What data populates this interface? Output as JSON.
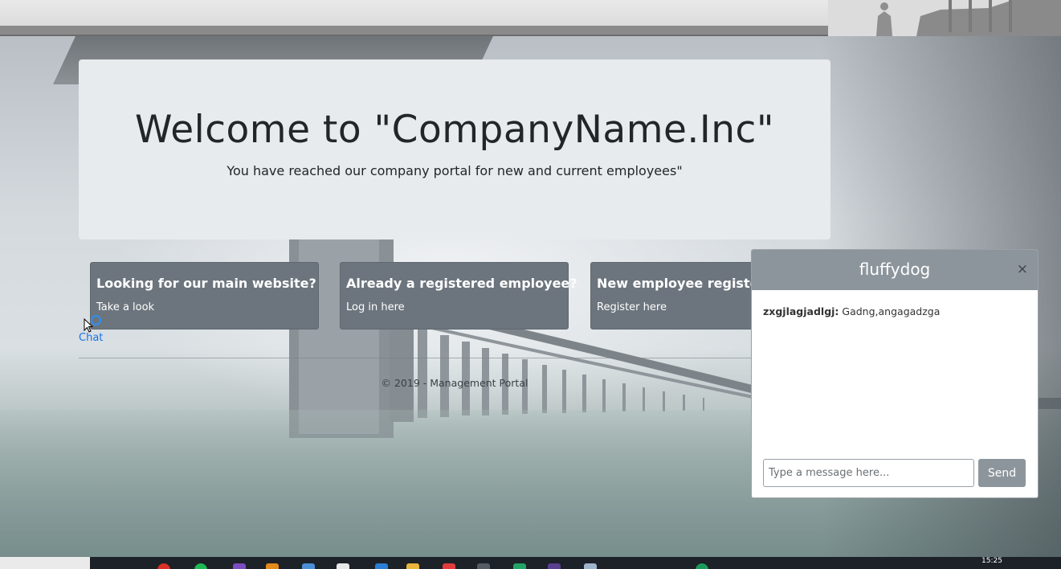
{
  "jumbotron": {
    "title": "Welcome to \"CompanyName.Inc\"",
    "subtitle": "You have reached our company portal for new and current employees\""
  },
  "cards": [
    {
      "title": "Looking for our main website?",
      "link": "Take a look"
    },
    {
      "title": "Already a registered employee?",
      "link": "Log in here"
    },
    {
      "title": "New employee register",
      "link": "Register here"
    }
  ],
  "chat_link": "Chat",
  "footer": "© 2019 - Management Portal",
  "chat": {
    "title": "fluffydog",
    "close": "×",
    "messages": [
      {
        "sender": "zxgjlagjadlgj:",
        "text": "Gadng,angagadzga"
      }
    ],
    "input_placeholder": "Type a message here...",
    "send_label": "Send"
  },
  "taskbar": {
    "time": "15:25",
    "icons": [
      "chrome-icon",
      "spotify-icon",
      "visual-studio-icon",
      "app-icon",
      "app-icon",
      "file-icon",
      "vscode-icon",
      "folder-icon",
      "app-icon",
      "app-icon",
      "app-icon",
      "app-icon",
      "app-icon",
      "app-icon"
    ]
  },
  "colors": {
    "card_bg": "#6c757d",
    "chat_header_bg": "#8d959c",
    "jumbotron_bg": "#e8ebee",
    "link_blue": "#1a73e8"
  }
}
